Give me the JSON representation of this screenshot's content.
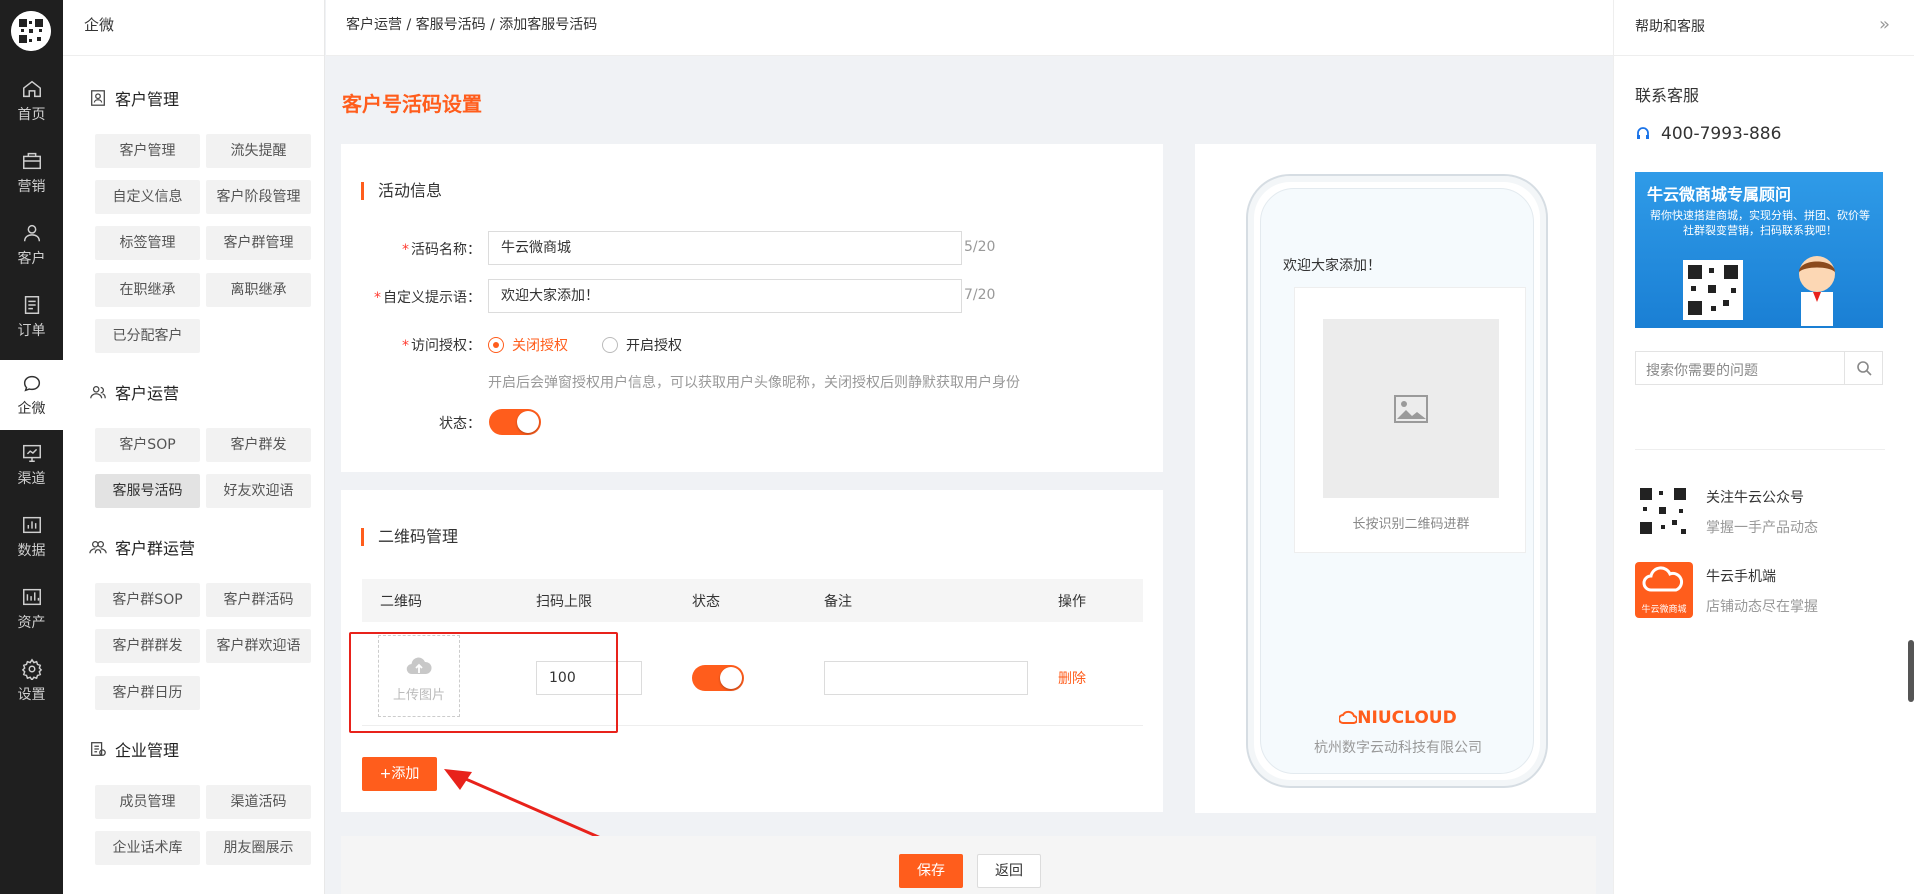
{
  "rail": {
    "items": [
      {
        "label": "首页",
        "icon": "home-icon"
      },
      {
        "label": "营销",
        "icon": "marketing-icon"
      },
      {
        "label": "客户",
        "icon": "user-icon"
      },
      {
        "label": "订单",
        "icon": "order-icon"
      },
      {
        "label": "企微",
        "icon": "wecom-icon"
      },
      {
        "label": "渠道",
        "icon": "channel-icon"
      },
      {
        "label": "数据",
        "icon": "data-icon"
      },
      {
        "label": "资产",
        "icon": "asset-icon"
      },
      {
        "label": "设置",
        "icon": "gear-icon"
      }
    ],
    "active_index": 4
  },
  "submenu": {
    "title": "企微",
    "groups": [
      {
        "title": "客户管理",
        "items": [
          "客户管理",
          "流失提醒",
          "自定义信息",
          "客户阶段管理",
          "标签管理",
          "客户群管理",
          "在职继承",
          "离职继承",
          "已分配客户"
        ]
      },
      {
        "title": "客户运营",
        "items": [
          "客户SOP",
          "客户群发",
          "客服号活码",
          "好友欢迎语"
        ],
        "active_item": "客服号活码"
      },
      {
        "title": "客户群运营",
        "items": [
          "客户群SOP",
          "客户群活码",
          "客户群群发",
          "客户群欢迎语",
          "客户群日历"
        ]
      },
      {
        "title": "企业管理",
        "items": [
          "成员管理",
          "渠道活码",
          "企业话术库",
          "朋友圈展示"
        ]
      }
    ]
  },
  "breadcrumb": "客户运营 / 客服号活码 / 添加客服号活码",
  "page_title": "客户号活码设置",
  "activity": {
    "section_title": "活动信息",
    "name_label": "活码名称：",
    "name_value": "牛云微商城",
    "name_count": "5/20",
    "prompt_label": "自定义提示语：",
    "prompt_value": "欢迎大家添加！",
    "prompt_count": "7/20",
    "auth_label": "访问授权：",
    "auth_options": [
      "关闭授权",
      "开启授权"
    ],
    "auth_selected": "关闭授权",
    "auth_hint": "开启后会弹窗授权用户信息，可以获取用户头像昵称，关闭授权后则静默获取用户身份",
    "status_label": "状态：",
    "required_mark": "*"
  },
  "qr_manage": {
    "section_title": "二维码管理",
    "columns": [
      "二维码",
      "扫码上限",
      "状态",
      "备注",
      "操作"
    ],
    "rows": [
      {
        "upload_label": "上传图片",
        "limit": "100",
        "remark": "",
        "action": "删除"
      }
    ],
    "add_button": "+添加"
  },
  "footer": {
    "save": "保存",
    "back": "返回"
  },
  "preview": {
    "welcome": "欢迎大家添加！",
    "qr_caption": "长按识别二维码进群",
    "brand": "NIUCLOUD",
    "company": "杭州数字云动科技有限公司"
  },
  "help": {
    "title": "帮助和客服",
    "contact_title": "联系客服",
    "phone": "400-7993-886",
    "banner_title": "牛云微商城专属顾问",
    "banner_text": "帮你快速搭建商城，实现分销、拼团、砍价等社群裂变营销，扫码联系我吧！",
    "search_placeholder": "搜索你需要的问题",
    "follow_title": "关注牛云公众号",
    "follow_sub": "掌握一手产品动态",
    "app_title": "牛云手机端",
    "app_sub": "店铺动态尽在掌握",
    "app_badge": "牛云微商城"
  },
  "colors": {
    "accent": "#ff5d1c",
    "rail_bg": "#1f1f1f",
    "highlight_box": "#e8221b"
  }
}
